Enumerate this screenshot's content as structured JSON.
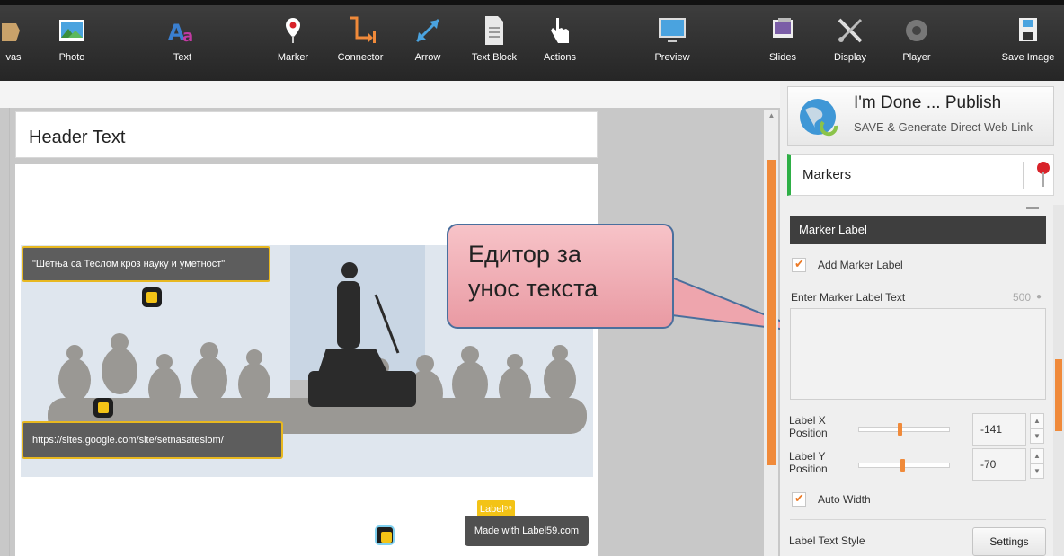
{
  "toolbar": {
    "items": [
      {
        "label": "vas",
        "icon": "canvas-icon"
      },
      {
        "label": "Photo",
        "icon": "photo-icon"
      },
      {
        "label": "Text",
        "icon": "text-icon"
      },
      {
        "label": "Marker",
        "icon": "marker-icon"
      },
      {
        "label": "Connector",
        "icon": "connector-icon"
      },
      {
        "label": "Arrow",
        "icon": "arrow-icon"
      },
      {
        "label": "Text Block",
        "icon": "text-block-icon"
      },
      {
        "label": "Actions",
        "icon": "actions-icon"
      },
      {
        "label": "Preview",
        "icon": "preview-icon"
      },
      {
        "label": "Slides",
        "icon": "slides-icon"
      },
      {
        "label": "Display",
        "icon": "display-icon"
      },
      {
        "label": "Player",
        "icon": "player-icon"
      },
      {
        "label": "Save Image",
        "icon": "save-image-icon"
      }
    ]
  },
  "canvas": {
    "header_text": "Header Text",
    "label_1": "\"Шетња са Теслом кроз науку и уметност\"",
    "label_2": "https://sites.google.com/site/setnasateslom/",
    "label59_tag": "Label⁵⁹",
    "made_with": "Made with Label59.com"
  },
  "callout": {
    "line1": "Едитор за",
    "line2": "унос  текста"
  },
  "panel": {
    "publish_title": "I'm Done ... Publish",
    "publish_subtitle": "SAVE & Generate Direct Web Link",
    "markers_title": "Markers",
    "marker_label_head": "Marker Label",
    "add_marker_label": "Add Marker Label",
    "enter_text_label": "Enter Marker Label Text",
    "char_limit": "500",
    "label_x": "Label X",
    "label_y": "Label Y",
    "position": "Position",
    "x_value": "-141",
    "y_value": "-70",
    "x_slider_level": 0.45,
    "y_slider_level": 0.48,
    "auto_width": "Auto Width",
    "label_text_style": "Label Text Style",
    "settings_button": "Settings"
  },
  "colors": {
    "accent_orange": "#f08a3a",
    "marker_yellow": "#f3c316",
    "callout_pink": "#f2b0b7"
  }
}
